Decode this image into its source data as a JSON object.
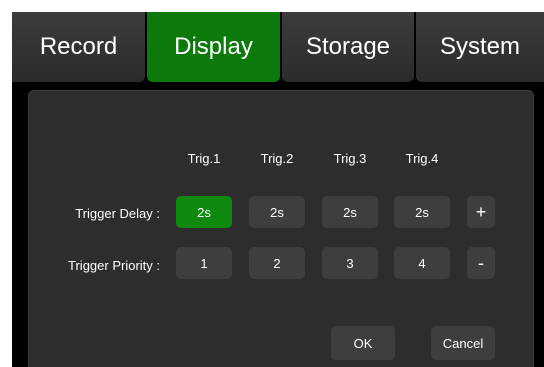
{
  "tabs": {
    "record": "Record",
    "display": "Display",
    "storage": "Storage",
    "system": "System",
    "active": "Display"
  },
  "dialog": {
    "columns": [
      "Trig.1",
      "Trig.2",
      "Trig.3",
      "Trig.4"
    ],
    "trigger_delay": {
      "label": "Trigger Delay :",
      "values": [
        "2s",
        "2s",
        "2s",
        "2s"
      ],
      "selected_index": 0,
      "increment_label": "+"
    },
    "trigger_priority": {
      "label": "Trigger Priority :",
      "values": [
        "1",
        "2",
        "3",
        "4"
      ],
      "decrement_label": "-"
    },
    "ok_label": "OK",
    "cancel_label": "Cancel"
  },
  "colors": {
    "active_green": "#0f8a0f",
    "tab_green": "#0b7a0b",
    "panel": "#2d2d2d",
    "button": "#3e3e3e",
    "background": "#000000"
  }
}
